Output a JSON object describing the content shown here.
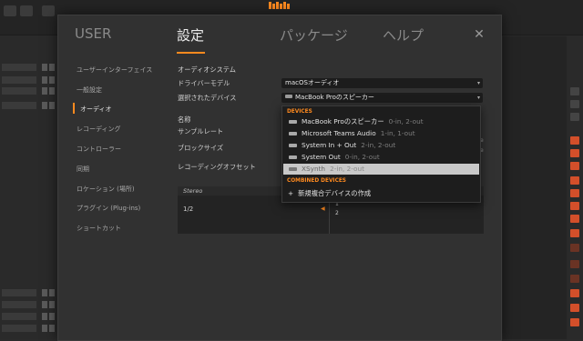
{
  "tabs": [
    {
      "label": "USER"
    },
    {
      "label": "設定"
    },
    {
      "label": "パッケージ"
    },
    {
      "label": "ヘルプ"
    }
  ],
  "close_glyph": "✕",
  "sidebar": {
    "items": [
      {
        "label": "ユーザーインターフェイス"
      },
      {
        "label": "一般設定"
      },
      {
        "label": "オーディオ"
      },
      {
        "label": "レコーディング"
      },
      {
        "label": "コントローラー"
      },
      {
        "label": "同期"
      },
      {
        "label": "ロケーション (場所)"
      },
      {
        "label": "プラグイン (Plug-ins)"
      },
      {
        "label": "ショートカット"
      }
    ]
  },
  "audio": {
    "section_title": "オーディオシステム",
    "driver_label": "ドライバーモデル",
    "driver_value": "macOSオーディオ",
    "device_label": "選択されたデバイス",
    "device_value": "MacBook Proのスピーカー",
    "name_label": "名称",
    "samplerate_label": "サンプルレート",
    "blocksize_label": "ブロックサイズ",
    "rec_offset_label": "レコーディングオフセット",
    "stereo_label": "Stereo",
    "channel_label": "1/2",
    "channel_num_1": "1",
    "channel_num_2": "2"
  },
  "dropdown": {
    "devices_header": "DEVICES",
    "items": [
      {
        "name": "MacBook Proのスピーカー",
        "io": "0-in, 2-out"
      },
      {
        "name": "Microsoft Teams Audio",
        "io": "1-in, 1-out"
      },
      {
        "name": "System In + Out",
        "io": "2-in, 2-out"
      },
      {
        "name": "System Out",
        "io": "0-in, 2-out"
      },
      {
        "name": "XSynth",
        "io": "2-in, 2-out"
      }
    ],
    "combined_header": "COMBINED DEVICES",
    "new_label": "新規複合デバイスの作成",
    "new_glyph": "+"
  },
  "colors": {
    "accent": "#ff8a1f",
    "background": "#313131"
  }
}
